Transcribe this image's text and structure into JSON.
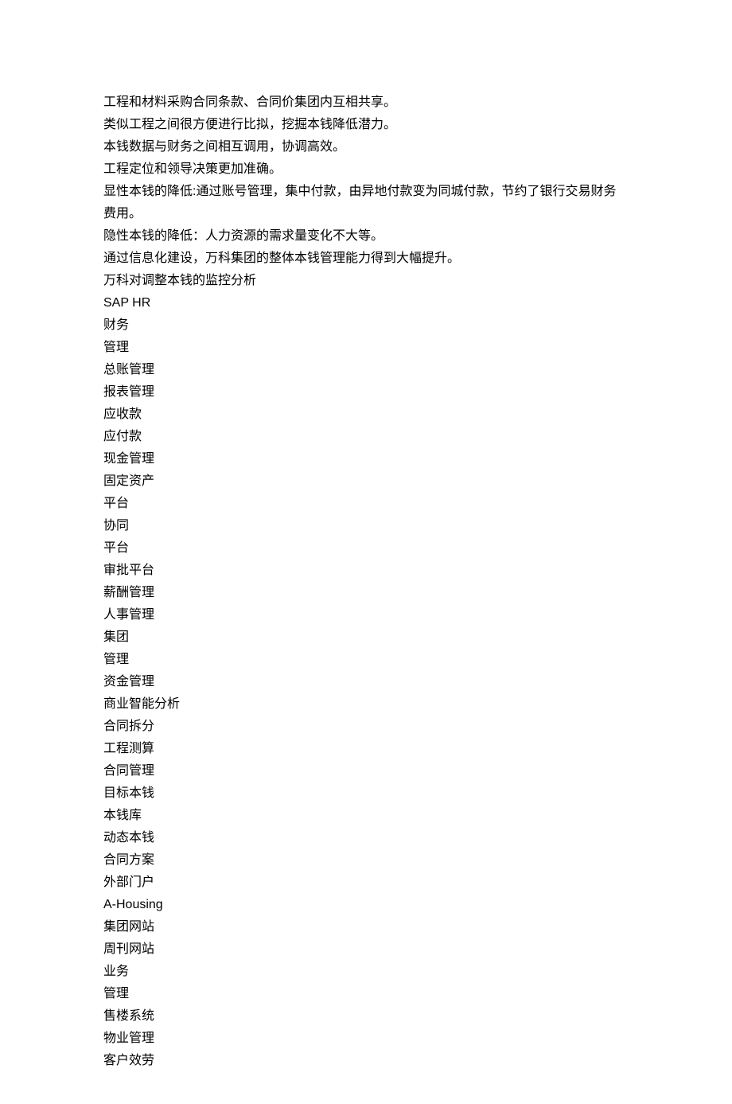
{
  "lines": [
    "工程和材料采购合同条款、合同价集团内互相共享。",
    "类似工程之间很方便进行比拟，挖掘本钱降低潜力。",
    "本钱数据与财务之间相互调用，协调高效。",
    "工程定位和领导决策更加准确。",
    "显性本钱的降低:通过账号管理，集中付款，由异地付款变为同城付款，节约了银行交易财务费用。",
    "隐性本钱的降低：人力资源的需求量变化不大等。",
    "通过信息化建设，万科集团的整体本钱管理能力得到大幅提升。",
    "万科对调整本钱的监控分析",
    "SAP HR",
    "财务",
    "管理",
    "总账管理",
    "报表管理",
    "应收款",
    "应付款",
    "现金管理",
    "固定资产",
    "平台",
    "协同",
    "平台",
    "审批平台",
    "薪酬管理",
    "人事管理",
    "集团",
    "管理",
    "资金管理",
    "商业智能分析",
    "合同拆分",
    "工程测算",
    "合同管理",
    "目标本钱",
    "本钱库",
    "动态本钱",
    "合同方案",
    "外部门户",
    "A-Housing",
    "集团网站",
    "周刊网站",
    "业务",
    "管理",
    "售楼系统",
    "物业管理",
    "客户效劳"
  ]
}
